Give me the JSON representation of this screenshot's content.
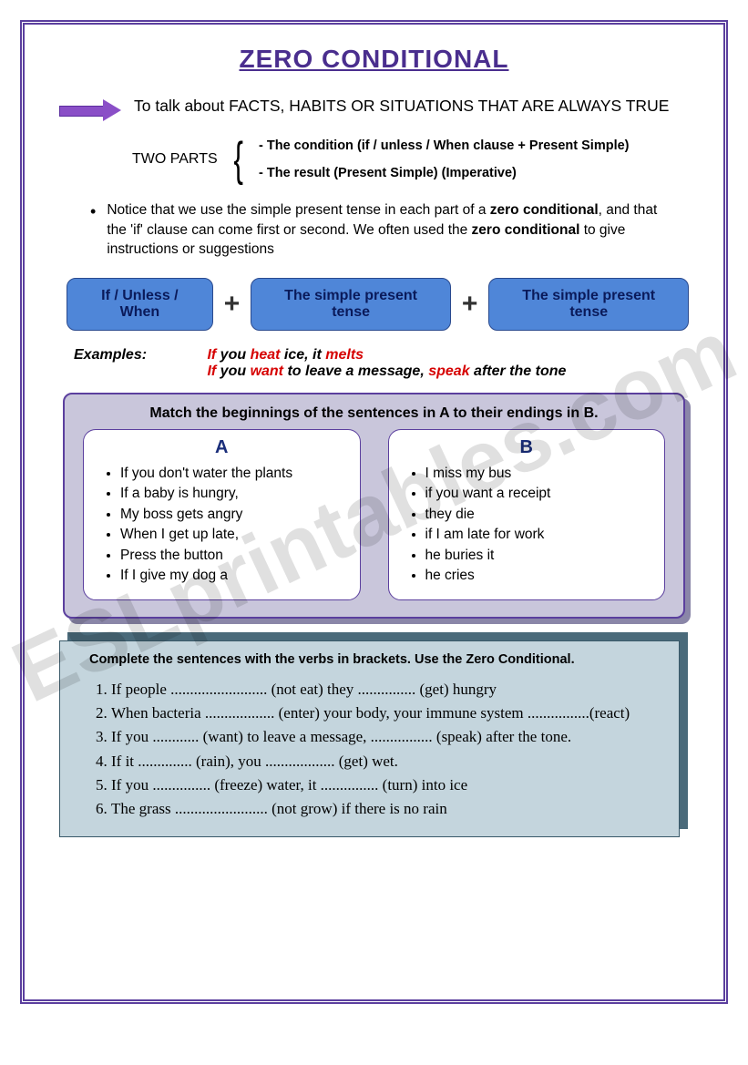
{
  "title": "ZERO CONDITIONAL",
  "intro": "To talk about FACTS, HABITS OR SITUATIONS THAT ARE ALWAYS TRUE",
  "two_parts": {
    "label": "TWO PARTS",
    "line1": "- The condition (if / unless / When  clause + Present Simple)",
    "line2": "- The result  (Present Simple) (Imperative)"
  },
  "notice_a": "Notice that we use the simple present tense in each part of a ",
  "notice_b": "zero conditional",
  "notice_c": ", and that the 'if' clause can come first or second. We often used the ",
  "notice_d": "zero conditional",
  "notice_e": " to give instructions or suggestions",
  "formula": {
    "box1": "If / Unless / When",
    "box2": "The simple present tense",
    "box3": "The simple present  tense"
  },
  "examples_label": "Examples:",
  "ex1": {
    "p1": "If ",
    "r1": "you ",
    "v1": "heat",
    "p2": " ice, it ",
    "v2": "melts"
  },
  "ex2": {
    "p1": "If ",
    "r1": "you ",
    "v1": "want",
    "p2": " to leave a message, ",
    "v2": "speak",
    "p3": " after the tone"
  },
  "match": {
    "title": "Match the beginnings of the sentences in A to their endings in B.",
    "headA": "A",
    "headB": "B",
    "a": [
      "If you don't water the plants",
      "If a baby is hungry,",
      "My boss gets angry",
      "When I get up late,",
      "Press the button",
      "If I give my dog a"
    ],
    "b": [
      "I miss my bus",
      "if you want a receipt",
      "they die",
      "if I am late for work",
      "he buries it",
      "he cries"
    ]
  },
  "complete": {
    "title": "Complete the sentences with the verbs in brackets. Use the Zero Conditional.",
    "items": [
      "If people ......................... (not eat) they ............... (get) hungry",
      "When bacteria .................. (enter) your body, your immune system ................(react)",
      "If you ............ (want) to leave a message, ................ (speak) after the tone.",
      "If it .............. (rain), you .................. (get) wet.",
      "If you ............... (freeze) water, it ............... (turn) into ice",
      "The grass ........................ (not grow) if there is no rain"
    ]
  },
  "watermark": "ESLprintables.com"
}
